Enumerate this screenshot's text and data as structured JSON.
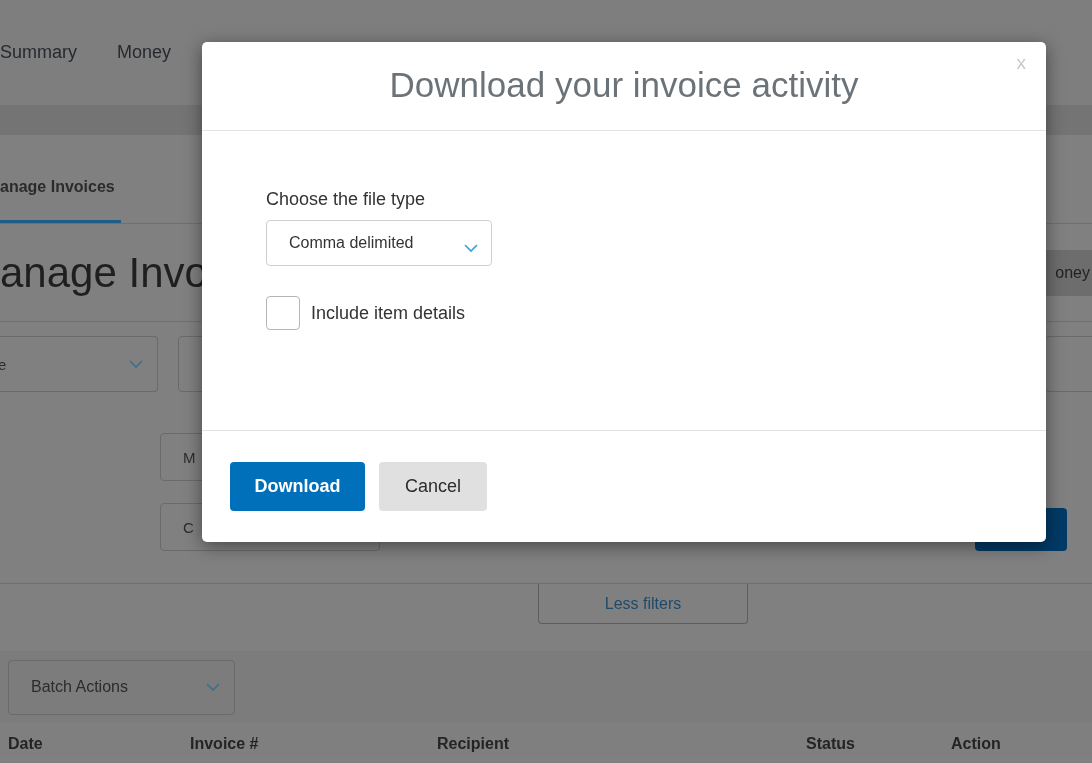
{
  "nav": {
    "items": [
      {
        "label": "Summary"
      },
      {
        "label": "Money"
      }
    ]
  },
  "subnav": {
    "tabs": [
      {
        "label": "anage Invoices",
        "selected": true
      }
    ]
  },
  "page_title": "anage Invo",
  "filters": {
    "type_dropdown": "e",
    "field_row2": "M",
    "field_row3": "C",
    "side_button": "oney"
  },
  "less_filters": "Less filters",
  "batch_actions": "Batch Actions",
  "table": {
    "columns": [
      "Date",
      "Invoice #",
      "Recipient",
      "Status",
      "Action"
    ]
  },
  "modal": {
    "title": "Download your invoice activity",
    "close": "x",
    "file_type_label": "Choose the file type",
    "file_type_value": "Comma delimited",
    "include_details": {
      "label": "Include item details",
      "checked": false
    },
    "buttons": [
      {
        "label": "Download",
        "kind": "primary"
      },
      {
        "label": "Cancel",
        "kind": "secondary"
      }
    ]
  }
}
